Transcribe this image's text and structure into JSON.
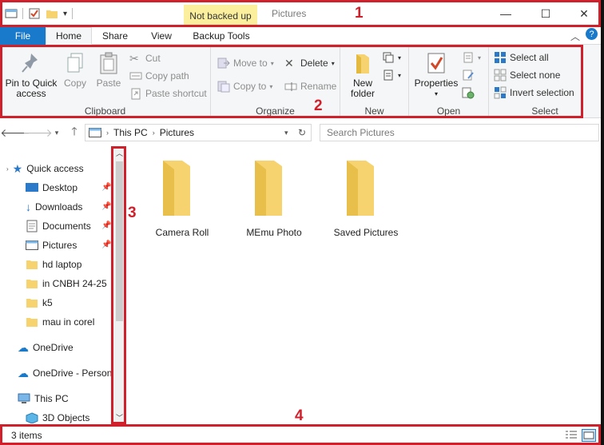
{
  "window": {
    "backup_status": "Not backed up",
    "title": "Pictures",
    "controls": {
      "minimize": "—",
      "maximize": "☐",
      "close": "✕"
    }
  },
  "tabs": [
    {
      "label": "File"
    },
    {
      "label": "Home"
    },
    {
      "label": "Share"
    },
    {
      "label": "View"
    },
    {
      "label": "Backup Tools"
    }
  ],
  "ribbon": {
    "clipboard": {
      "label": "Clipboard",
      "pin_line1": "Pin to Quick",
      "pin_line2": "access",
      "copy": "Copy",
      "paste": "Paste",
      "cut": "Cut",
      "copy_path": "Copy path",
      "paste_shortcut": "Paste shortcut"
    },
    "organize": {
      "label": "Organize",
      "move_to": "Move to",
      "copy_to": "Copy to",
      "delete": "Delete",
      "rename": "Rename"
    },
    "new": {
      "label": "New",
      "new_folder_line1": "New",
      "new_folder_line2": "folder"
    },
    "open": {
      "label": "Open",
      "properties": "Properties"
    },
    "select": {
      "label": "Select",
      "select_all": "Select all",
      "select_none": "Select none",
      "invert_selection": "Invert selection"
    }
  },
  "address": {
    "crumbs": [
      "This PC",
      "Pictures"
    ],
    "search_placeholder": "Search Pictures"
  },
  "nav": {
    "quick_access": "Quick access",
    "items": [
      {
        "label": "Desktop"
      },
      {
        "label": "Downloads"
      },
      {
        "label": "Documents"
      },
      {
        "label": "Pictures"
      },
      {
        "label": "hd laptop"
      },
      {
        "label": "in CNBH 24-25"
      },
      {
        "label": "k5"
      },
      {
        "label": "mau in corel"
      }
    ],
    "onedrive": "OneDrive",
    "onedrive_personal": "OneDrive - Person",
    "this_pc": "This PC",
    "objects_3d": "3D Objects"
  },
  "folders": [
    {
      "label": "Camera Roll"
    },
    {
      "label": "MEmu Photo"
    },
    {
      "label": "Saved Pictures"
    }
  ],
  "status": {
    "item_count": "3 items"
  },
  "annotations": [
    "1",
    "2",
    "3",
    "4"
  ],
  "colors": {
    "accent": "#1979ca",
    "annotation": "#d0202c",
    "backup_badge": "#fbee9c",
    "folder": "#f6d36e"
  }
}
